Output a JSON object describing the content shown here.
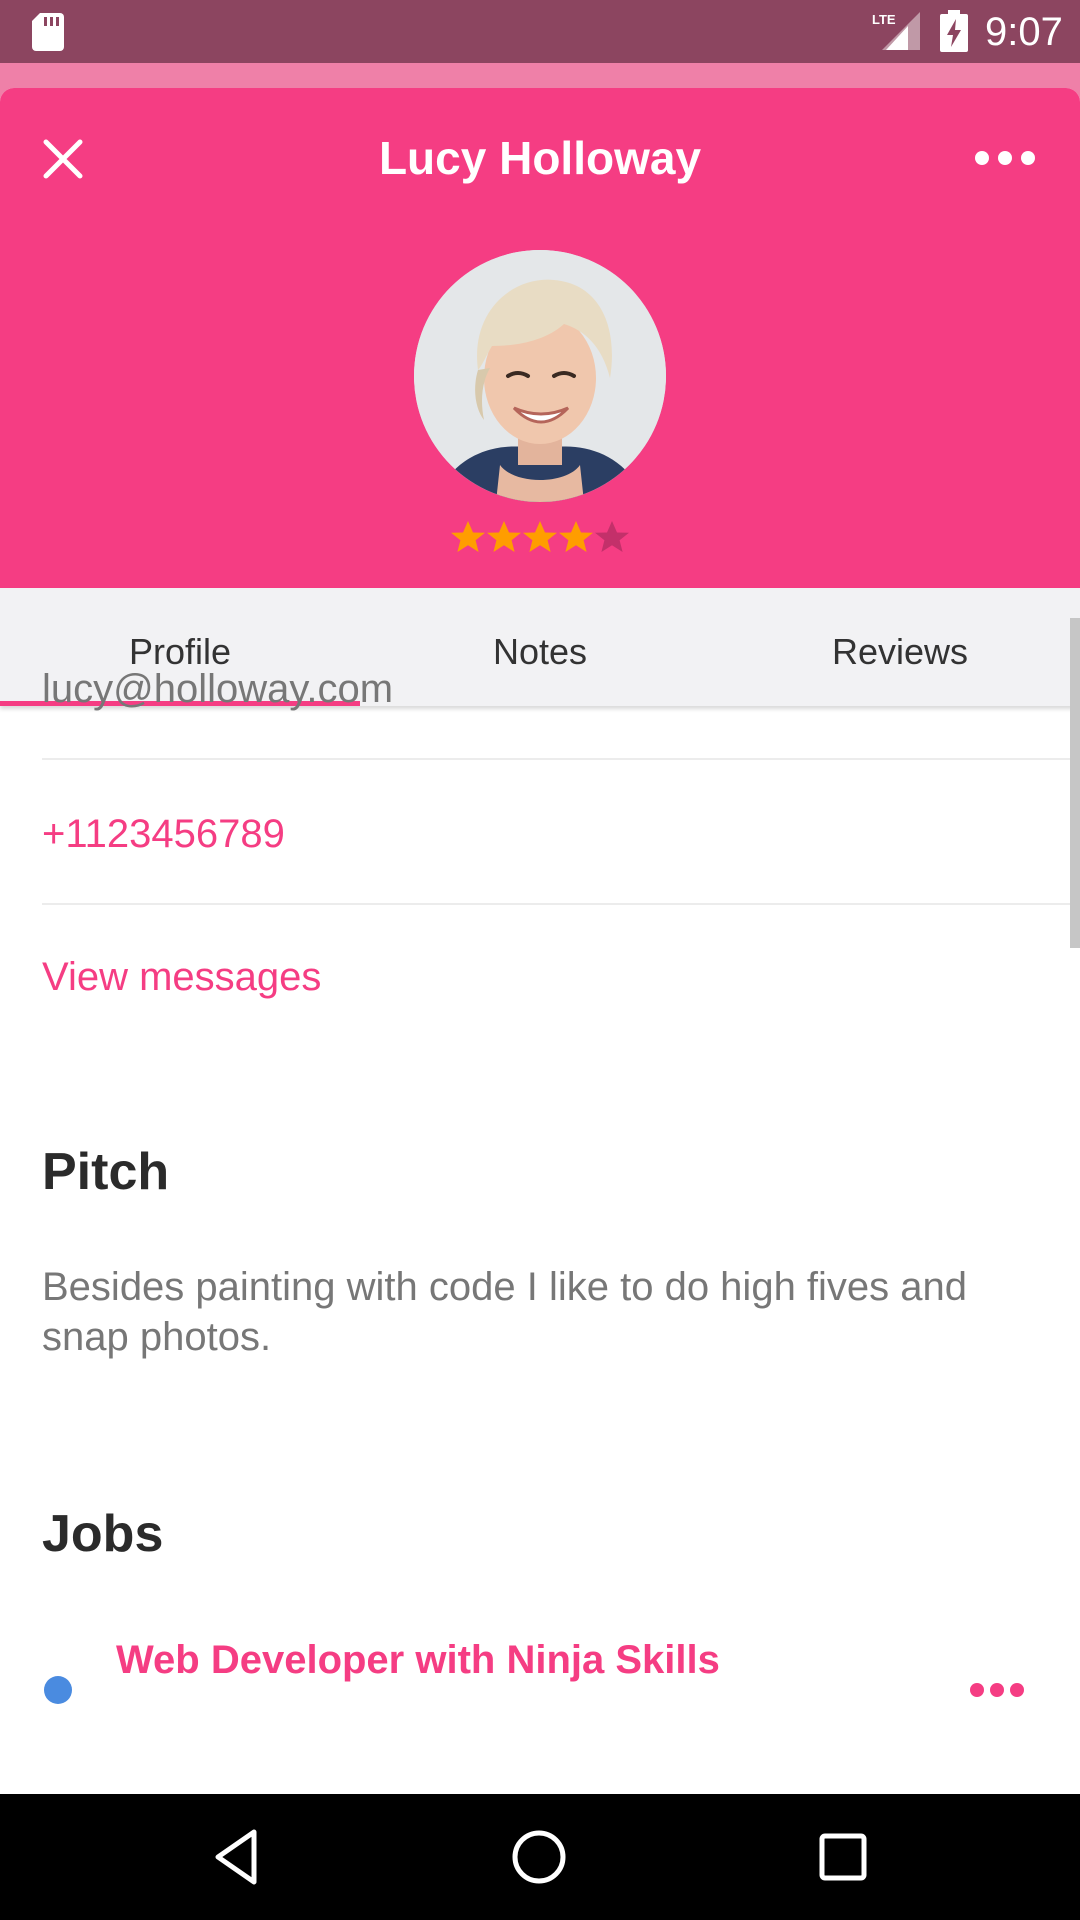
{
  "status_bar": {
    "time": "9:07",
    "network_label": "LTE",
    "icons": [
      "sd-card-icon",
      "signal-icon",
      "battery-charging-icon"
    ]
  },
  "header": {
    "title": "Lucy Holloway",
    "rating": 4,
    "rating_max": 5,
    "icons": [
      "close-icon",
      "more-icon"
    ],
    "colors": {
      "accent": "#f53d83",
      "star": "#ff9d00"
    }
  },
  "tabs": [
    {
      "label": "Profile",
      "selected": true
    },
    {
      "label": "Notes",
      "selected": false
    },
    {
      "label": "Reviews",
      "selected": false
    }
  ],
  "profile": {
    "email": "lucy@holloway.com",
    "phone": "+1123456789",
    "messages_link": "View messages",
    "pitch_title": "Pitch",
    "pitch_text": "Besides painting with code I like to do high fives and snap photos.",
    "jobs_title": "Jobs",
    "jobs": [
      {
        "title": "Web Developer with Ninja Skills",
        "status_color": "#4a8be0"
      }
    ]
  },
  "nav_bar": {
    "icons": [
      "back-icon",
      "home-icon",
      "recents-icon"
    ]
  }
}
